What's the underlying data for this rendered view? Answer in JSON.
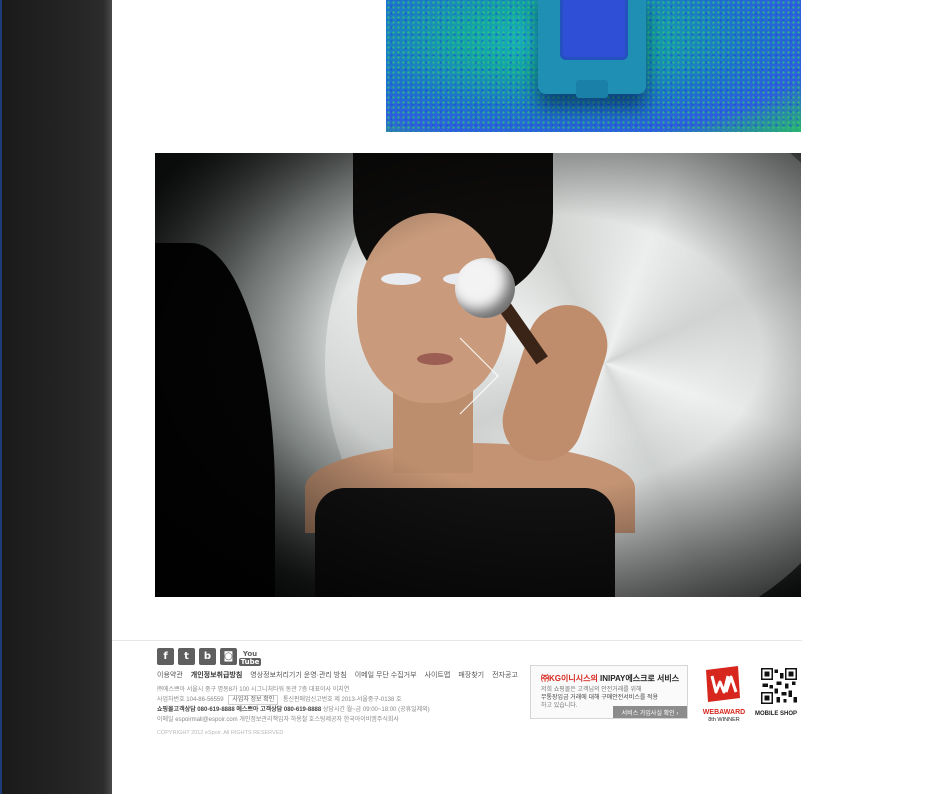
{
  "sidebar": {},
  "top_image": {
    "alt": ""
  },
  "hero": {
    "alt": ""
  },
  "footer": {
    "social_icons": [
      {
        "name": "facebook-icon",
        "glyph": "f"
      },
      {
        "name": "twitter-icon",
        "glyph": "t"
      },
      {
        "name": "blog-icon",
        "glyph": "b"
      },
      {
        "name": "instagram-icon",
        "glyph": "◙"
      }
    ],
    "youtube": {
      "top": "You",
      "bottom": "Tube"
    },
    "links": [
      "이용약관",
      "개인정보취급방침",
      "영상정보처리기기 운영·관리 방침",
      "이메일 무단 수집거부",
      "사이트맵",
      "매장찾기",
      "전자공고"
    ],
    "info": {
      "line1": "㈜에스쁘아  서울시 중구 명동8가 100 시그니처타워 동관 7층  대표이사 이지연",
      "line2_text": "사업자번호 104-86-56559",
      "line2_chip": "사업자 정보 확인",
      "line2_rest": "통신판매업신고번호 제 2013-서울중구-0138 호",
      "line3_bold1": "쇼핑몰고객상담 080-619-8888",
      "line3_bold2": "에스쁘아 고객상담 080-619-8888",
      "line3_rest": "상담시간 월~금 09:00~18:00 (공휴일제외)",
      "line4": "이메일 espoirmall@espoir.com   개인정보관리책임자 하용철   호스팅제공자 한국아이비엠주식회사"
    },
    "copyright": "COPYRIGHT 2012 eSpoir. All RIGHTS RESERVED",
    "inipay": {
      "head_red": "㈜KG이니시스의",
      "head_rest": " INIPAY에스크로 서비스",
      "body1": "저희 쇼핑몰은 고객님의 안전거래를 위해",
      "body2": "무통장입금 거래에 대해 구매안전서비스를 적용",
      "body3": "하고 있습니다.",
      "button": "서비스 가입사실 확인 ›"
    },
    "webaward": {
      "title": "WEBAWARD",
      "subtitle": "8th WINNER"
    },
    "qr": {
      "label": "MOBILE SHOP"
    }
  },
  "colors": {
    "sidebar": "#262626",
    "award_red": "#d7261e",
    "icon_gray": "#5f5f5f"
  }
}
